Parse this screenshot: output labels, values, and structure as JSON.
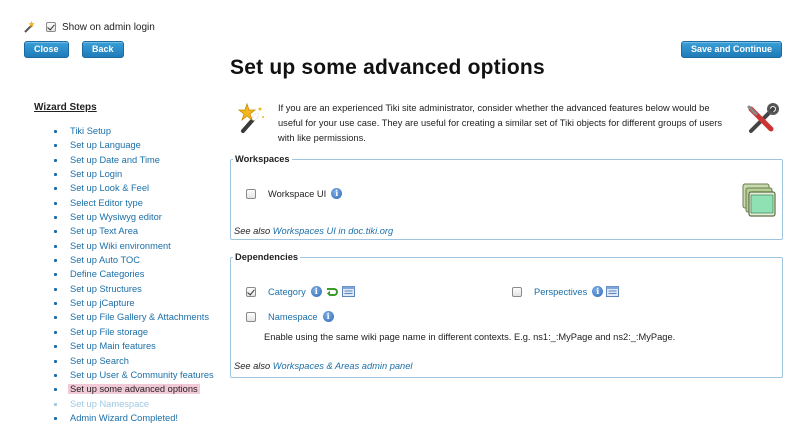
{
  "topbar": {
    "show_on_admin_login": "Show on admin login",
    "show_checked": true
  },
  "buttons": {
    "close": "Close",
    "back": "Back",
    "save_continue": "Save and Continue"
  },
  "page_title": "Set up some advanced options",
  "wizard": {
    "title": "Wizard Steps",
    "steps": [
      "Tiki Setup",
      "Set up Language",
      "Set up Date and Time",
      "Set up Login",
      "Set up Look & Feel",
      "Select Editor type",
      "Set up Wysiwyg editor",
      "Set up Text Area",
      "Set up Wiki environment",
      "Set up Auto TOC",
      "Define Categories",
      "Set up Structures",
      "Set up jCapture",
      "Set up File Gallery & Attachments",
      "Set up File storage",
      "Set up Main features",
      "Set up Search",
      "Set up User & Community features",
      "Set up some advanced options",
      "Set up Namespace",
      "Admin Wizard Completed!"
    ],
    "current_index": 18,
    "disabled_index": 19
  },
  "intro": "If you are an experienced Tiki site administrator, consider whether the advanced features below would be useful for your use case. They are useful for creating a similar set of Tiki objects for different groups of users with like permissions.",
  "workspaces": {
    "legend": "Workspaces",
    "workspace_ui_label": "Workspace UI",
    "workspace_ui_checked": false,
    "see_also_prefix": "See also ",
    "see_also_link": "Workspaces UI in doc.tiki.org"
  },
  "dependencies": {
    "legend": "Dependencies",
    "category_label": "Category",
    "category_checked": true,
    "perspectives_label": "Perspectives",
    "perspectives_checked": false,
    "namespace_label": "Namespace",
    "namespace_checked": false,
    "namespace_description": "Enable using the same wiki page name in different contexts. E.g. ns1:_:MyPage and ns2:_:MyPage.",
    "see_also_prefix": "See also ",
    "see_also_link": "Workspaces & Areas admin panel"
  },
  "colors": {
    "button": "#2a8dcc",
    "link": "#1b6fa8",
    "current_step_bg": "#f2c9d6",
    "fieldset_border": "#9fc4de"
  }
}
